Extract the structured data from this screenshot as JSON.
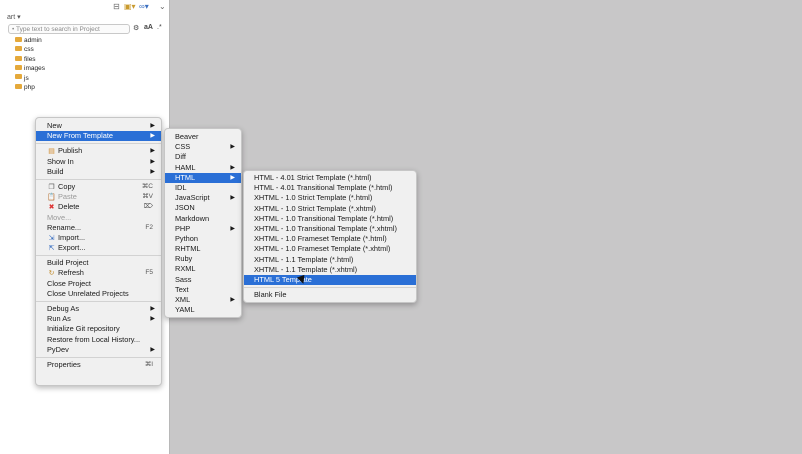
{
  "sidebar": {
    "project_selector": "art ▾",
    "search_placeholder": "• Type text to search in Project",
    "search_case_label": "aA",
    "tree": [
      "admin",
      "css",
      "files",
      "images",
      "js",
      "php"
    ]
  },
  "context_menu": [
    {
      "label": "New",
      "submenu": true
    },
    {
      "label": "New From Template",
      "submenu": true,
      "highlighted": true
    },
    {
      "sep": true
    },
    {
      "label": "Publish",
      "icon": "publish-icon",
      "submenu": true
    },
    {
      "label": "Show In",
      "submenu": true
    },
    {
      "label": "Build",
      "submenu": true
    },
    {
      "sep": true
    },
    {
      "label": "Copy",
      "icon": "copy-icon",
      "shortcut": "⌘C"
    },
    {
      "label": "Paste",
      "icon": "paste-icon",
      "shortcut": "⌘V",
      "disabled": true
    },
    {
      "label": "Delete",
      "icon": "delete-icon",
      "shortcut": "⌦"
    },
    {
      "label": "Move...",
      "disabled": true
    },
    {
      "label": "Rename...",
      "shortcut": "F2"
    },
    {
      "label": "Import...",
      "icon": "import-icon"
    },
    {
      "label": "Export...",
      "icon": "export-icon"
    },
    {
      "sep": true
    },
    {
      "label": "Build Project"
    },
    {
      "label": "Refresh",
      "icon": "refresh-icon",
      "shortcut": "F5"
    },
    {
      "label": "Close Project"
    },
    {
      "label": "Close Unrelated Projects"
    },
    {
      "sep": true
    },
    {
      "label": "Debug As",
      "submenu": true
    },
    {
      "label": "Run As",
      "submenu": true
    },
    {
      "label": "Initialize Git repository"
    },
    {
      "label": "Restore from Local History..."
    },
    {
      "label": "PyDev",
      "submenu": true
    },
    {
      "sep": true
    },
    {
      "label": "Properties",
      "shortcut": "⌘I"
    }
  ],
  "template_menu": [
    {
      "label": "Beaver"
    },
    {
      "label": "CSS",
      "submenu": true
    },
    {
      "label": "Diff"
    },
    {
      "label": "HAML",
      "submenu": true
    },
    {
      "label": "HTML",
      "submenu": true,
      "highlighted": true
    },
    {
      "label": "IDL"
    },
    {
      "label": "JavaScript",
      "submenu": true
    },
    {
      "label": "JSON"
    },
    {
      "label": "Markdown"
    },
    {
      "label": "PHP",
      "submenu": true
    },
    {
      "label": "Python"
    },
    {
      "label": "RHTML"
    },
    {
      "label": "Ruby"
    },
    {
      "label": "RXML"
    },
    {
      "label": "Sass"
    },
    {
      "label": "Text"
    },
    {
      "label": "XML",
      "submenu": true
    },
    {
      "label": "YAML"
    }
  ],
  "html_menu": [
    {
      "label": "HTML - 4.01 Strict Template (*.html)"
    },
    {
      "label": "HTML - 4.01 Transitional Template (*.html)"
    },
    {
      "label": "XHTML - 1.0 Strict Template (*.html)"
    },
    {
      "label": "XHTML - 1.0 Strict Template (*.xhtml)"
    },
    {
      "label": "XHTML - 1.0 Transitional Template (*.html)"
    },
    {
      "label": "XHTML - 1.0 Transitional Template (*.xhtml)"
    },
    {
      "label": "XHTML - 1.0 Frameset Template (*.html)"
    },
    {
      "label": "XHTML - 1.0 Frameset Template (*.xhtml)"
    },
    {
      "label": "XHTML - 1.1 Template (*.html)"
    },
    {
      "label": "XHTML - 1.1 Template (*.xhtml)"
    },
    {
      "label": "HTML 5 Template",
      "highlighted": true
    },
    {
      "sep": true
    },
    {
      "label": "Blank File"
    }
  ],
  "colors": {
    "highlight": "#2a6fd6",
    "folder": "#e5a93b",
    "workspace": "#c8c7c8"
  }
}
